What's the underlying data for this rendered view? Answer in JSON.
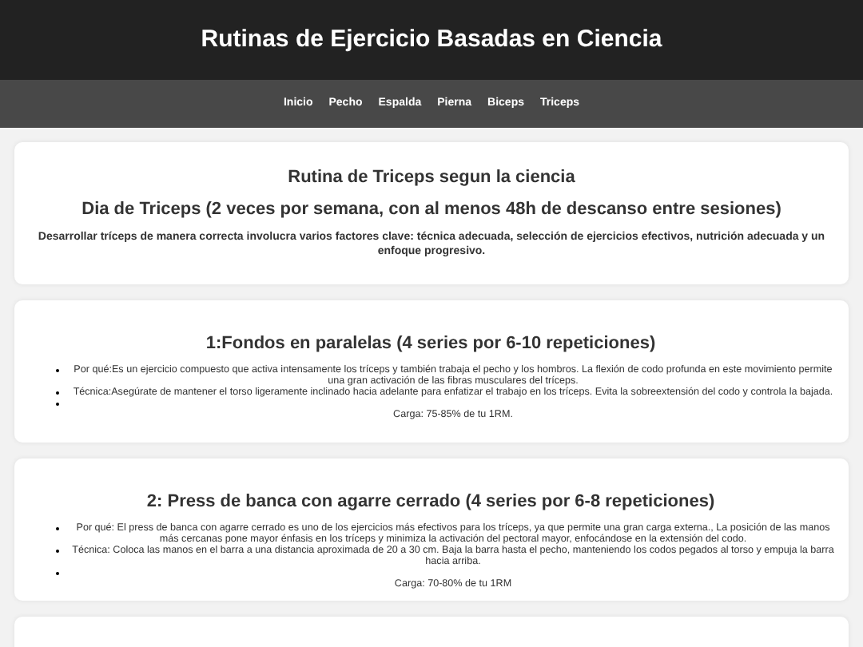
{
  "header": {
    "title": "Rutinas de Ejercicio Basadas en Ciencia"
  },
  "nav": {
    "items": [
      {
        "label": "Inicio"
      },
      {
        "label": "Pecho"
      },
      {
        "label": "Espalda"
      },
      {
        "label": "Pierna"
      },
      {
        "label": "Biceps"
      },
      {
        "label": "Triceps"
      }
    ]
  },
  "intro": {
    "title": "Rutina de Triceps segun la ciencia",
    "subtitle": "Dia de Triceps (2 veces por semana, con al menos 48h de descanso entre sesiones)",
    "description": "Desarrollar tríceps de manera correcta involucra varios factores clave: técnica adecuada, selección de ejercicios efectivos, nutrición adecuada y un enfoque progresivo."
  },
  "exercises": [
    {
      "title": "1:Fondos en paralelas (4 series por 6-10 repeticiones)",
      "points": [
        {
          "kind": "inline",
          "text": "Por qué:Es un ejercicio compuesto que activa intensamente los tríceps y también trabaja el pecho y los hombros. La flexión de codo profunda en este movimiento permite una gran activación de las fibras musculares del tríceps."
        },
        {
          "kind": "inline",
          "text": "Técnica:Asegúrate de mantener el torso ligeramente inclinado hacia adelante para enfatizar el trabajo en los tríceps. Evita la sobreextensión del codo y controla la bajada."
        },
        {
          "kind": "block",
          "text": "Carga: 75-85% de tu 1RM."
        }
      ]
    },
    {
      "title": "2: Press de banca con agarre cerrado (4 series por 6-8 repeticiones)",
      "points": [
        {
          "kind": "inline",
          "text": "Por qué: El press de banca con agarre cerrado es uno de los ejercicios más efectivos para los tríceps, ya que permite una gran carga externa., La posición de las manos más cercanas pone mayor énfasis en los tríceps y minimiza la activación del pectoral mayor, enfocándose en la extensión del codo."
        },
        {
          "kind": "inline",
          "text": "Técnica: Coloca las manos en el barra a una distancia aproximada de 20 a 30 cm. Baja la barra hasta el pecho, manteniendo los codos pegados al torso y empuja la barra hacia arriba."
        },
        {
          "kind": "block",
          "text": "Carga: 70-80% de tu 1RM"
        }
      ]
    }
  ]
}
